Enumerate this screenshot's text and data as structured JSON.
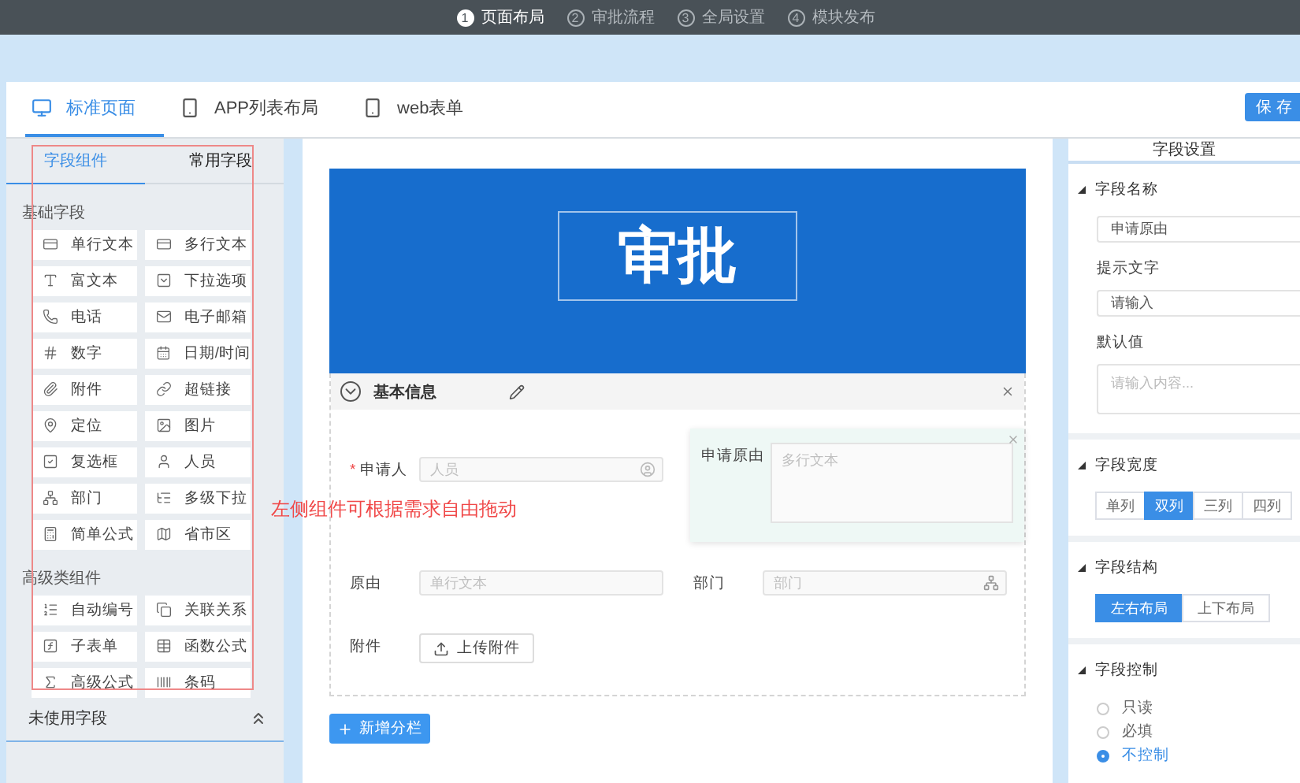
{
  "steps": [
    {
      "number": "1",
      "label": "页面布局",
      "selected": true
    },
    {
      "number": "2",
      "label": "审批流程",
      "selected": false
    },
    {
      "number": "3",
      "label": "全局设置",
      "selected": false
    },
    {
      "number": "4",
      "label": "模块发布",
      "selected": false
    }
  ],
  "view_tabs": [
    {
      "label": "标准页面",
      "selected": true,
      "kind": "desktop"
    },
    {
      "label": "APP列表布局",
      "selected": false,
      "kind": "mobile"
    },
    {
      "label": "web表单",
      "selected": false,
      "kind": "mobile"
    }
  ],
  "save_button": "保 存",
  "left_panel": {
    "tabs": [
      {
        "label": "字段组件",
        "selected": true
      },
      {
        "label": "常用字段",
        "selected": false
      }
    ],
    "groups": [
      {
        "title": "基础字段",
        "items": [
          "单行文本",
          "多行文本",
          "富文本",
          "下拉选项",
          "电话",
          "电子邮箱",
          "数字",
          "日期/时间",
          "附件",
          "超链接",
          "定位",
          "图片",
          "复选框",
          "人员",
          "部门",
          "多级下拉",
          "简单公式",
          "省市区"
        ]
      },
      {
        "title": "高级类组件",
        "items": [
          "自动编号",
          "关联关系",
          "子表单",
          "函数公式",
          "高级公式",
          "条码"
        ]
      }
    ],
    "unused_fields": "未使用字段"
  },
  "annotation": "左侧组件可根据需求自由拖动",
  "canvas": {
    "banner_title": "审批",
    "section": {
      "title": "基本信息",
      "fields": [
        {
          "kind": "person",
          "required_mark": "*",
          "label": "申请人",
          "placeholder": "人员",
          "selected": false
        },
        {
          "kind": "textarea",
          "label": "申请原由",
          "placeholder": "多行文本",
          "selected": true
        },
        {
          "kind": "text",
          "label": "原由",
          "placeholder": "单行文本",
          "selected": false
        },
        {
          "kind": "department",
          "label": "部门",
          "placeholder": "部门",
          "selected": false
        },
        {
          "kind": "upload",
          "label": "附件",
          "button": "上传附件",
          "selected": false
        }
      ]
    },
    "add_column_button": "新增分栏"
  },
  "settings": {
    "title": "字段设置",
    "name": {
      "label": "字段名称",
      "value": "申请原由"
    },
    "hint": {
      "label": "提示文字",
      "value": "请输入"
    },
    "default": {
      "label": "默认值",
      "placeholder": "请输入内容..."
    },
    "width": {
      "label": "字段宽度",
      "options": [
        {
          "label": "单列",
          "selected": false
        },
        {
          "label": "双列",
          "selected": true
        },
        {
          "label": "三列",
          "selected": false
        },
        {
          "label": "四列",
          "selected": false
        }
      ]
    },
    "structure": {
      "label": "字段结构",
      "options": [
        {
          "label": "左右布局",
          "selected": true
        },
        {
          "label": "上下布局",
          "selected": false
        }
      ]
    },
    "control": {
      "label": "字段控制",
      "options": [
        {
          "label": "只读",
          "selected": false
        },
        {
          "label": "必填",
          "selected": false
        },
        {
          "label": "不控制",
          "selected": true
        }
      ]
    }
  }
}
